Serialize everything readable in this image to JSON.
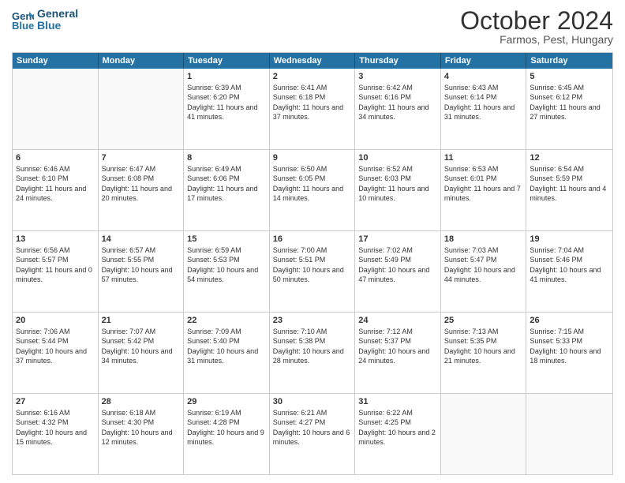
{
  "header": {
    "logo_line1": "General",
    "logo_line2": "Blue",
    "month_title": "October 2024",
    "location": "Farmos, Pest, Hungary"
  },
  "weekdays": [
    "Sunday",
    "Monday",
    "Tuesday",
    "Wednesday",
    "Thursday",
    "Friday",
    "Saturday"
  ],
  "weeks": [
    [
      {
        "day": "",
        "sunrise": "",
        "sunset": "",
        "daylight": ""
      },
      {
        "day": "",
        "sunrise": "",
        "sunset": "",
        "daylight": ""
      },
      {
        "day": "1",
        "sunrise": "Sunrise: 6:39 AM",
        "sunset": "Sunset: 6:20 PM",
        "daylight": "Daylight: 11 hours and 41 minutes."
      },
      {
        "day": "2",
        "sunrise": "Sunrise: 6:41 AM",
        "sunset": "Sunset: 6:18 PM",
        "daylight": "Daylight: 11 hours and 37 minutes."
      },
      {
        "day": "3",
        "sunrise": "Sunrise: 6:42 AM",
        "sunset": "Sunset: 6:16 PM",
        "daylight": "Daylight: 11 hours and 34 minutes."
      },
      {
        "day": "4",
        "sunrise": "Sunrise: 6:43 AM",
        "sunset": "Sunset: 6:14 PM",
        "daylight": "Daylight: 11 hours and 31 minutes."
      },
      {
        "day": "5",
        "sunrise": "Sunrise: 6:45 AM",
        "sunset": "Sunset: 6:12 PM",
        "daylight": "Daylight: 11 hours and 27 minutes."
      }
    ],
    [
      {
        "day": "6",
        "sunrise": "Sunrise: 6:46 AM",
        "sunset": "Sunset: 6:10 PM",
        "daylight": "Daylight: 11 hours and 24 minutes."
      },
      {
        "day": "7",
        "sunrise": "Sunrise: 6:47 AM",
        "sunset": "Sunset: 6:08 PM",
        "daylight": "Daylight: 11 hours and 20 minutes."
      },
      {
        "day": "8",
        "sunrise": "Sunrise: 6:49 AM",
        "sunset": "Sunset: 6:06 PM",
        "daylight": "Daylight: 11 hours and 17 minutes."
      },
      {
        "day": "9",
        "sunrise": "Sunrise: 6:50 AM",
        "sunset": "Sunset: 6:05 PM",
        "daylight": "Daylight: 11 hours and 14 minutes."
      },
      {
        "day": "10",
        "sunrise": "Sunrise: 6:52 AM",
        "sunset": "Sunset: 6:03 PM",
        "daylight": "Daylight: 11 hours and 10 minutes."
      },
      {
        "day": "11",
        "sunrise": "Sunrise: 6:53 AM",
        "sunset": "Sunset: 6:01 PM",
        "daylight": "Daylight: 11 hours and 7 minutes."
      },
      {
        "day": "12",
        "sunrise": "Sunrise: 6:54 AM",
        "sunset": "Sunset: 5:59 PM",
        "daylight": "Daylight: 11 hours and 4 minutes."
      }
    ],
    [
      {
        "day": "13",
        "sunrise": "Sunrise: 6:56 AM",
        "sunset": "Sunset: 5:57 PM",
        "daylight": "Daylight: 11 hours and 0 minutes."
      },
      {
        "day": "14",
        "sunrise": "Sunrise: 6:57 AM",
        "sunset": "Sunset: 5:55 PM",
        "daylight": "Daylight: 10 hours and 57 minutes."
      },
      {
        "day": "15",
        "sunrise": "Sunrise: 6:59 AM",
        "sunset": "Sunset: 5:53 PM",
        "daylight": "Daylight: 10 hours and 54 minutes."
      },
      {
        "day": "16",
        "sunrise": "Sunrise: 7:00 AM",
        "sunset": "Sunset: 5:51 PM",
        "daylight": "Daylight: 10 hours and 50 minutes."
      },
      {
        "day": "17",
        "sunrise": "Sunrise: 7:02 AM",
        "sunset": "Sunset: 5:49 PM",
        "daylight": "Daylight: 10 hours and 47 minutes."
      },
      {
        "day": "18",
        "sunrise": "Sunrise: 7:03 AM",
        "sunset": "Sunset: 5:47 PM",
        "daylight": "Daylight: 10 hours and 44 minutes."
      },
      {
        "day": "19",
        "sunrise": "Sunrise: 7:04 AM",
        "sunset": "Sunset: 5:46 PM",
        "daylight": "Daylight: 10 hours and 41 minutes."
      }
    ],
    [
      {
        "day": "20",
        "sunrise": "Sunrise: 7:06 AM",
        "sunset": "Sunset: 5:44 PM",
        "daylight": "Daylight: 10 hours and 37 minutes."
      },
      {
        "day": "21",
        "sunrise": "Sunrise: 7:07 AM",
        "sunset": "Sunset: 5:42 PM",
        "daylight": "Daylight: 10 hours and 34 minutes."
      },
      {
        "day": "22",
        "sunrise": "Sunrise: 7:09 AM",
        "sunset": "Sunset: 5:40 PM",
        "daylight": "Daylight: 10 hours and 31 minutes."
      },
      {
        "day": "23",
        "sunrise": "Sunrise: 7:10 AM",
        "sunset": "Sunset: 5:38 PM",
        "daylight": "Daylight: 10 hours and 28 minutes."
      },
      {
        "day": "24",
        "sunrise": "Sunrise: 7:12 AM",
        "sunset": "Sunset: 5:37 PM",
        "daylight": "Daylight: 10 hours and 24 minutes."
      },
      {
        "day": "25",
        "sunrise": "Sunrise: 7:13 AM",
        "sunset": "Sunset: 5:35 PM",
        "daylight": "Daylight: 10 hours and 21 minutes."
      },
      {
        "day": "26",
        "sunrise": "Sunrise: 7:15 AM",
        "sunset": "Sunset: 5:33 PM",
        "daylight": "Daylight: 10 hours and 18 minutes."
      }
    ],
    [
      {
        "day": "27",
        "sunrise": "Sunrise: 6:16 AM",
        "sunset": "Sunset: 4:32 PM",
        "daylight": "Daylight: 10 hours and 15 minutes."
      },
      {
        "day": "28",
        "sunrise": "Sunrise: 6:18 AM",
        "sunset": "Sunset: 4:30 PM",
        "daylight": "Daylight: 10 hours and 12 minutes."
      },
      {
        "day": "29",
        "sunrise": "Sunrise: 6:19 AM",
        "sunset": "Sunset: 4:28 PM",
        "daylight": "Daylight: 10 hours and 9 minutes."
      },
      {
        "day": "30",
        "sunrise": "Sunrise: 6:21 AM",
        "sunset": "Sunset: 4:27 PM",
        "daylight": "Daylight: 10 hours and 6 minutes."
      },
      {
        "day": "31",
        "sunrise": "Sunrise: 6:22 AM",
        "sunset": "Sunset: 4:25 PM",
        "daylight": "Daylight: 10 hours and 2 minutes."
      },
      {
        "day": "",
        "sunrise": "",
        "sunset": "",
        "daylight": ""
      },
      {
        "day": "",
        "sunrise": "",
        "sunset": "",
        "daylight": ""
      }
    ]
  ]
}
